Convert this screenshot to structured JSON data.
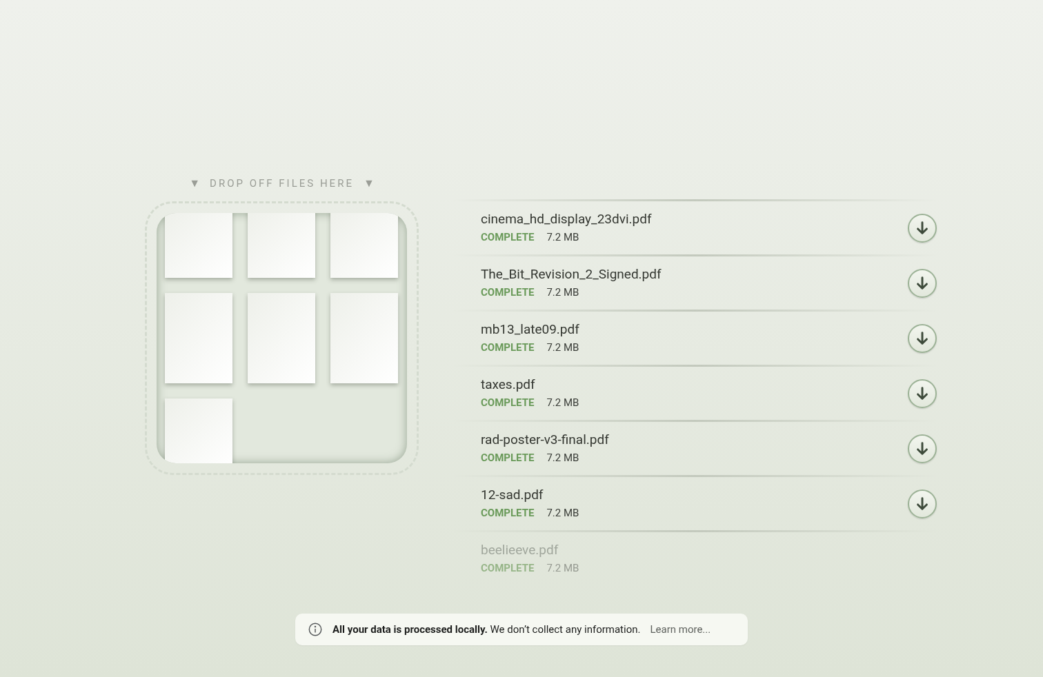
{
  "drop_zone": {
    "label": "DROP OFF FILES HERE",
    "arrow": "▼"
  },
  "files": [
    {
      "name": "cinema_hd_display_23dvi.pdf",
      "status": "COMPLETE",
      "size": "7.2 MB",
      "faded": false
    },
    {
      "name": "The_Bit_Revision_2_Signed.pdf",
      "status": "COMPLETE",
      "size": "7.2 MB",
      "faded": false
    },
    {
      "name": "mb13_late09.pdf",
      "status": "COMPLETE",
      "size": "7.2 MB",
      "faded": false
    },
    {
      "name": "taxes.pdf",
      "status": "COMPLETE",
      "size": "7.2 MB",
      "faded": false
    },
    {
      "name": "rad-poster-v3-final.pdf",
      "status": "COMPLETE",
      "size": "7.2 MB",
      "faded": false
    },
    {
      "name": "12-sad.pdf",
      "status": "COMPLETE",
      "size": "7.2 MB",
      "faded": false
    },
    {
      "name": "beelieeve.pdf",
      "status": "COMPLETE",
      "size": "7.2 MB",
      "faded": true
    }
  ],
  "notice": {
    "text": "**All your data is processed locally.** We don’t collect any information.",
    "link": "Learn more..."
  }
}
